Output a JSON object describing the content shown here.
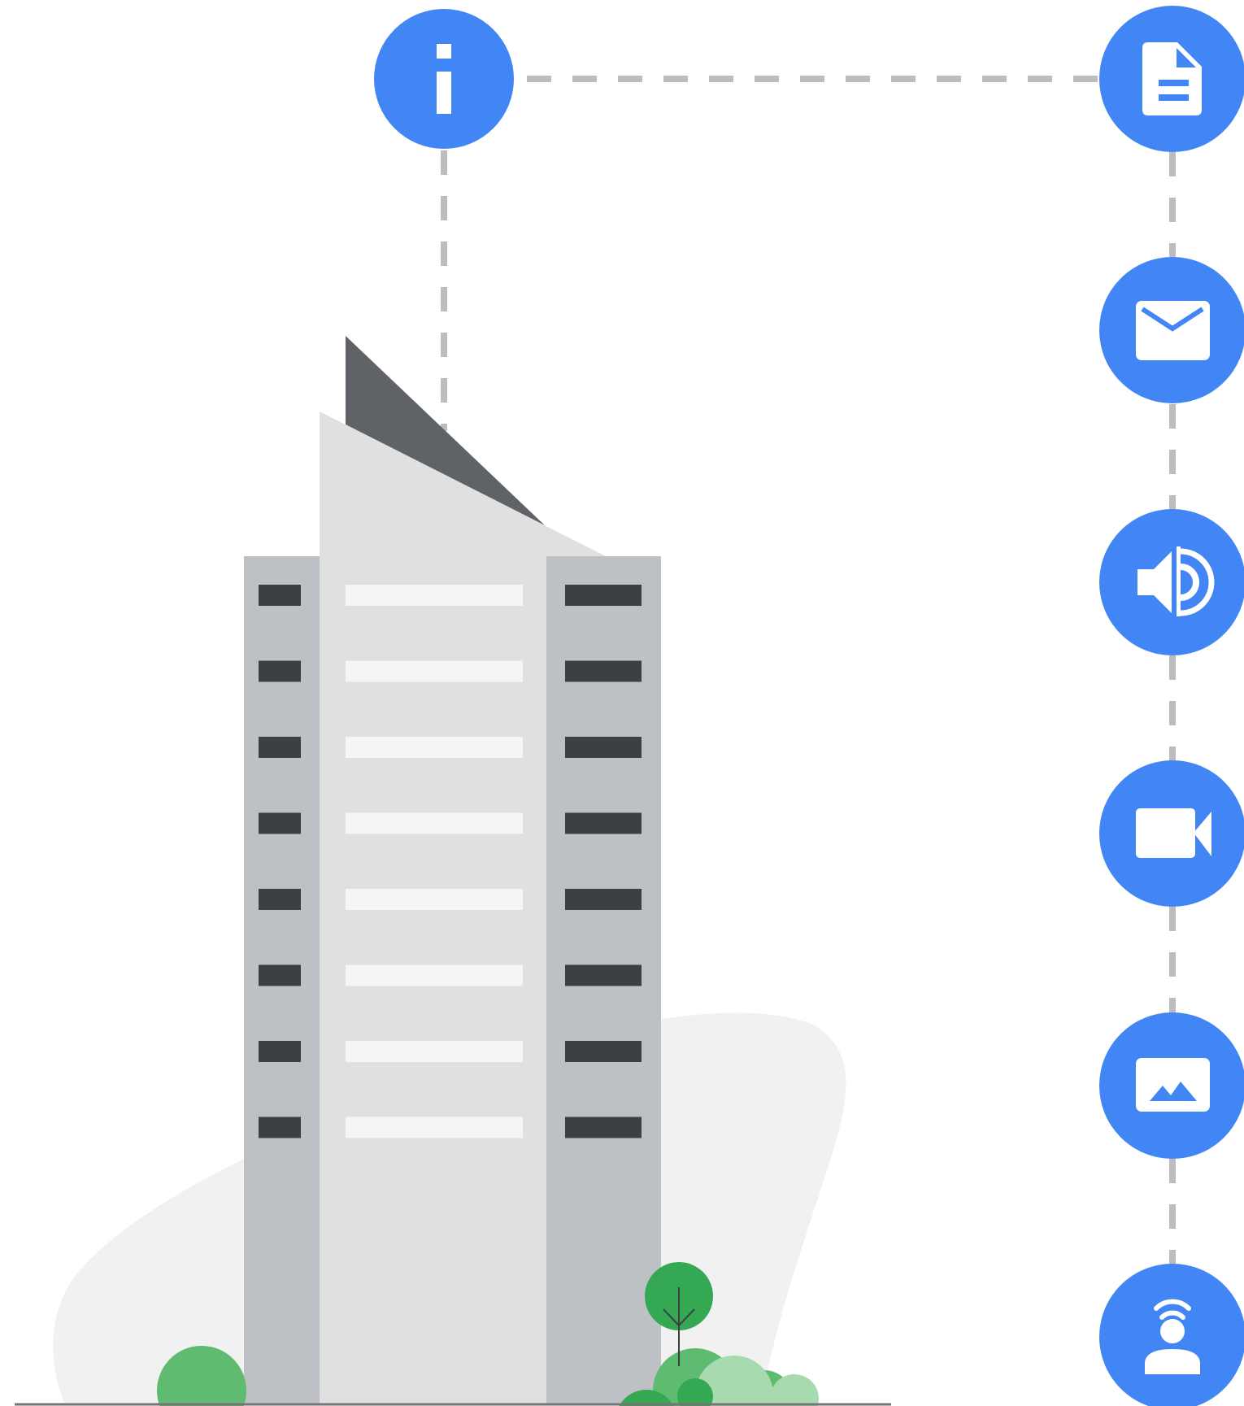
{
  "scene": {
    "subject": "building",
    "info_node": {
      "icon": "info-icon"
    },
    "content_nodes": [
      {
        "icon": "document-icon"
      },
      {
        "icon": "mail-icon"
      },
      {
        "icon": "audio-icon"
      },
      {
        "icon": "video-icon"
      },
      {
        "icon": "image-icon"
      },
      {
        "icon": "broadcast-person-icon"
      }
    ],
    "connector_style": "dashed"
  },
  "colors": {
    "node_blue": "#4285F4",
    "connector_gray": "#BDBDBD",
    "tower_main": "#E0E0E0",
    "tower_side": "#BDC1C6",
    "roof_dark": "#5F6368",
    "window_dark": "#3C4043",
    "window_light": "#F5F5F5",
    "backdrop": "#F1F1F1",
    "ground_line": "#757575",
    "tree_dark": "#34A853",
    "tree_mid": "#5FBB6F",
    "tree_light": "#A8DAB0",
    "icon_white": "#FFFFFF"
  }
}
